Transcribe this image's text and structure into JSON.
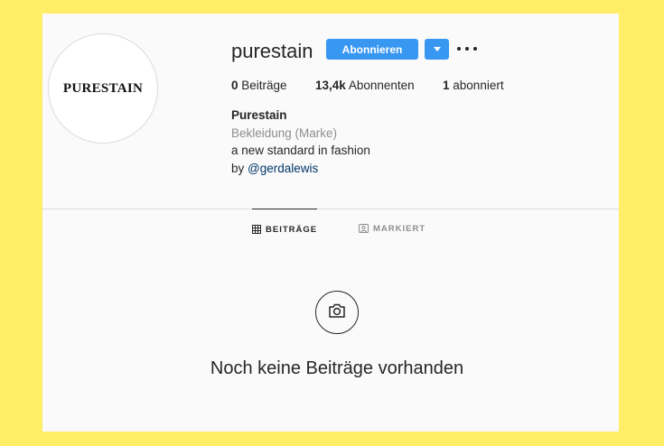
{
  "profile": {
    "username": "purestain",
    "avatar_text": "PURESTAIN",
    "follow_label": "Abonnieren",
    "dropdown_icon": "caret-down-icon",
    "more_icon": "more-horizontal-icon"
  },
  "stats": {
    "posts_count": "0",
    "posts_label": "Beiträge",
    "followers_count": "13,4k",
    "followers_label": "Abonnenten",
    "following_count": "1",
    "following_label": "abonniert"
  },
  "bio": {
    "name": "Purestain",
    "category": "Bekleidung (Marke)",
    "text": "a new standard in fashion",
    "by_prefix": "by",
    "mention": "@gerdalewis"
  },
  "tabs": [
    {
      "label": "BEITRÄGE",
      "icon": "grid-icon",
      "active": true
    },
    {
      "label": "MARKIERT",
      "icon": "tagged-icon",
      "active": false
    }
  ],
  "empty_state": {
    "icon": "camera-icon",
    "title": "Noch keine Beiträge vorhanden"
  },
  "colors": {
    "background": "#FFEE66",
    "panel": "#FAFAFA",
    "accent": "#3897F0",
    "link": "#003569",
    "muted": "#8E8E8E"
  }
}
